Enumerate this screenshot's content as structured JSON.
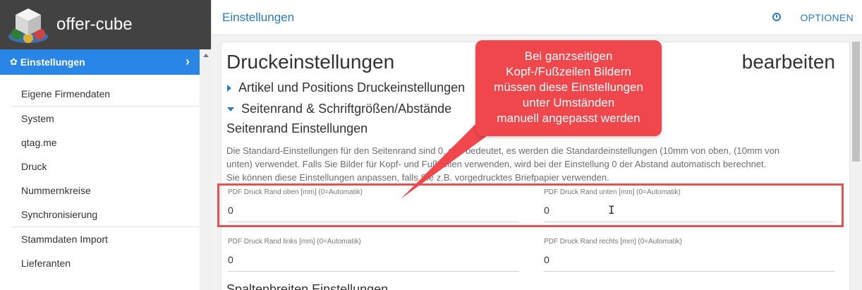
{
  "app": {
    "name": "offer-cube"
  },
  "sidebar": {
    "active_item": "Einstellungen",
    "items": [
      {
        "label": "Eigene Firmendaten"
      },
      {
        "label": "System"
      },
      {
        "label": "qtag.me"
      },
      {
        "label": "Druck"
      },
      {
        "label": "Nummernkreise"
      },
      {
        "label": "Synchronisierung"
      },
      {
        "label": "Stammdaten Import"
      },
      {
        "label": "Lieferanten"
      }
    ]
  },
  "topbar": {
    "title": "Einstellungen",
    "options_label": "OPTIONEN"
  },
  "main": {
    "title": "Druckeinstellungen",
    "edit_label": "bearbeiten",
    "sections": [
      {
        "label": "Artikel und Positions Druckeinstellungen",
        "expanded": false
      },
      {
        "label": "Seitenrand & Schriftgrößen/Abstände",
        "expanded": true
      }
    ],
    "subheading": "Seitenrand Einstellungen",
    "description": [
      "Die Standard-Einstellungen für den Seitenrand sind 0, das bedeutet, es werden die Standardeinstellungen (10mm von oben, (10mm von",
      "unten) verwendet. Falls Sie Bilder für Kopf- und Fußzeilen verwenden, wird bei der Einstellung 0 der Abstand automatisch berechnet.",
      "Sie können diese Einstellungen anpassen, falls Sie z.B. vorgedrucktes Briefpapier verwenden."
    ],
    "fields": [
      {
        "label": "PDF Druck Rand oben [mm] (0=Automatik)",
        "value": "0"
      },
      {
        "label": "PDF Druck Rand unten [mm] (0=Automatik)",
        "value": "0"
      },
      {
        "label": "PDF Druck Rand links [mm] (0=Automatik)",
        "value": "0"
      },
      {
        "label": "PDF Druck Rand rechts [mm] (0=Automatik)",
        "value": "0"
      }
    ],
    "next_heading": "Spaltenbreiten Einstellungen"
  },
  "callout": {
    "lines": [
      "Bei ganzseitigen",
      "Kopf-/Fußzeilen Bildern",
      "müssen diese Einstellungen",
      "unter Umständen",
      "manuell angepasst werden"
    ],
    "color": "#f0474c"
  },
  "colors": {
    "accent": "#2a86e6",
    "header_bg": "#424242",
    "highlight": "#e05454"
  }
}
